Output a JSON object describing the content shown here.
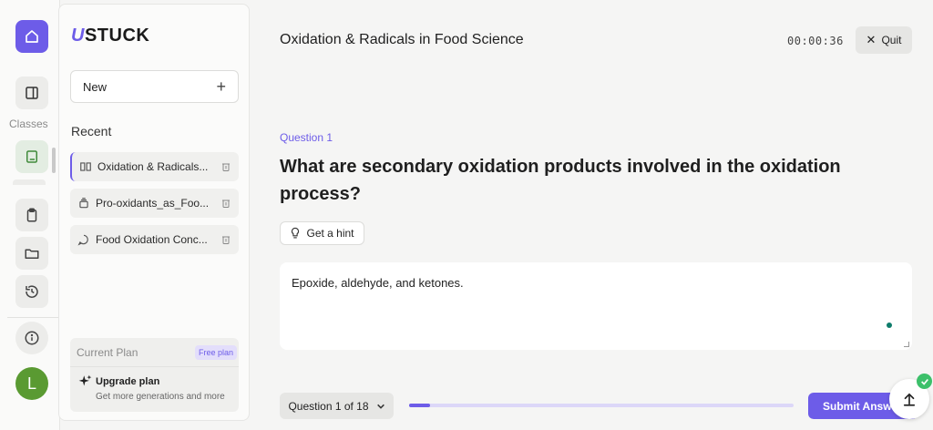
{
  "app": {
    "logo_text": "STUCK",
    "logo_mark": "U"
  },
  "rail": {
    "classes_label": "Classes",
    "avatar_initial": "L"
  },
  "sidebar": {
    "new_label": "New",
    "recent_title": "Recent",
    "recent_items": [
      {
        "label": "Oxidation & Radicals...",
        "icon": "book-icon",
        "active": true
      },
      {
        "label": "Pro-oxidants_as_Foo...",
        "icon": "layers-icon",
        "active": false
      },
      {
        "label": "Food Oxidation Conc...",
        "icon": "chat-icon",
        "active": false
      }
    ],
    "plan": {
      "label": "Current Plan",
      "badge": "Free plan",
      "upgrade_title": "Upgrade plan",
      "upgrade_sub": "Get more generations and more"
    }
  },
  "header": {
    "title": "Oxidation & Radicals in Food Science",
    "timer": "00:00:36",
    "quit_label": "Quit"
  },
  "question": {
    "number_label": "Question 1",
    "text": "What are secondary oxidation products involved in the oxidation process?",
    "hint_label": "Get a hint",
    "answer_value": "Epoxide, aldehyde, and ketones."
  },
  "footer": {
    "selector_label": "Question 1 of 18",
    "progress_fraction": 0.055,
    "submit_label": "Submit Answer"
  },
  "colors": {
    "accent": "#6d5ce8",
    "avatar": "#5a9a32",
    "success": "#3cc06a"
  }
}
